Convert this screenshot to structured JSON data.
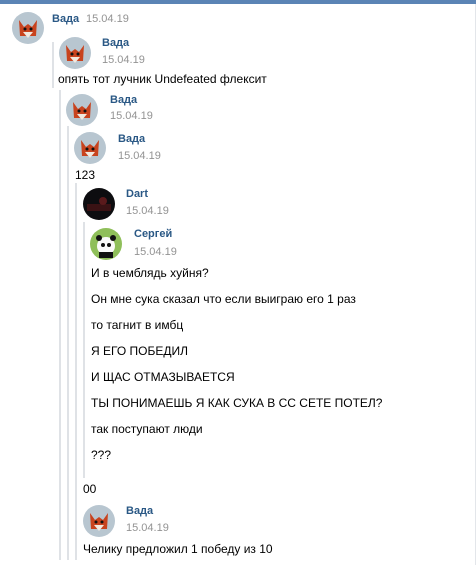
{
  "comments": [
    {
      "author": "Вада",
      "date": "15.04.19",
      "avatar": "fox-avatar"
    },
    {
      "author": "Вада",
      "date": "15.04.19",
      "avatar": "fox-avatar",
      "text": "опять тот лучник Undefeated флексит"
    },
    {
      "author": "Вада",
      "date": "15.04.19",
      "avatar": "fox-avatar"
    },
    {
      "author": "Вада",
      "date": "15.04.19",
      "avatar": "fox-avatar",
      "text": "123"
    },
    {
      "author": "Dart",
      "date": "15.04.19",
      "avatar": "dark-avatar"
    },
    {
      "author": "Сергей",
      "date": "15.04.19",
      "avatar": "panda-avatar",
      "lines": [
        "И в чемблядь хуйня?",
        "Он мне сука сказал что если выиграю его 1 раз",
        "то тагнит в имбц",
        "Я ЕГО ПОБЕДИЛ",
        "И ЩАС ОТМАЗЫВАЕТСЯ",
        "ТЫ ПОНИМАЕШЬ Я КАК СУКА В СС СЕТЕ ПОТЕЛ?",
        "так поступают люди",
        "???"
      ]
    },
    {
      "text": "00"
    },
    {
      "author": "Вада",
      "date": "15.04.19",
      "avatar": "fox-avatar",
      "text": "Челику предложил 1 победу из 10"
    }
  ],
  "colors": {
    "accent": "#5b84b5",
    "name": "#2a5885",
    "date": "#939393",
    "thread_line": "#dfe2e6"
  }
}
